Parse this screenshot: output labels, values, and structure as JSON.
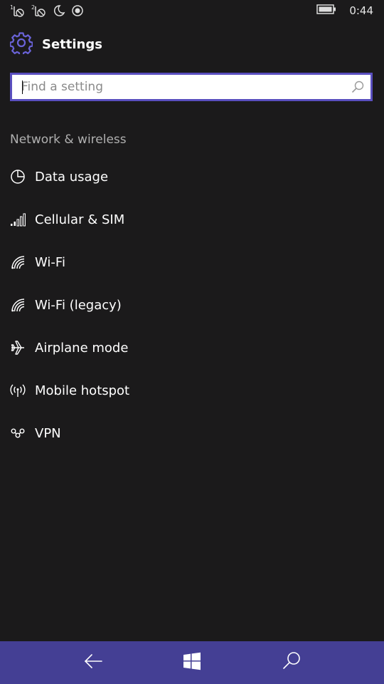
{
  "status": {
    "time": "0:44",
    "icons": [
      "sim1-no-signal-icon",
      "sim2-no-signal-icon",
      "quiet-hours-moon-icon",
      "location-icon"
    ],
    "battery_icon": "battery-icon"
  },
  "header": {
    "title": "Settings",
    "icon": "gear-icon"
  },
  "search": {
    "placeholder": "Find a setting",
    "value": "",
    "icon": "search-icon"
  },
  "section": {
    "label": "Network & wireless"
  },
  "menu": {
    "items": [
      {
        "label": "Data usage",
        "icon": "pie-chart-icon"
      },
      {
        "label": "Cellular & SIM",
        "icon": "signal-bars-icon"
      },
      {
        "label": "Wi-Fi",
        "icon": "wifi-icon"
      },
      {
        "label": "Wi-Fi (legacy)",
        "icon": "wifi-icon"
      },
      {
        "label": "Airplane mode",
        "icon": "airplane-icon"
      },
      {
        "label": "Mobile hotspot",
        "icon": "hotspot-icon"
      },
      {
        "label": "VPN",
        "icon": "vpn-icon"
      }
    ]
  },
  "navbar": {
    "back_icon": "back-arrow-icon",
    "home_icon": "windows-logo-icon",
    "search_icon": "search-icon"
  },
  "colors": {
    "background": "#1b1a1b",
    "accent": "#5a4fbf",
    "navbar": "#443f94"
  }
}
